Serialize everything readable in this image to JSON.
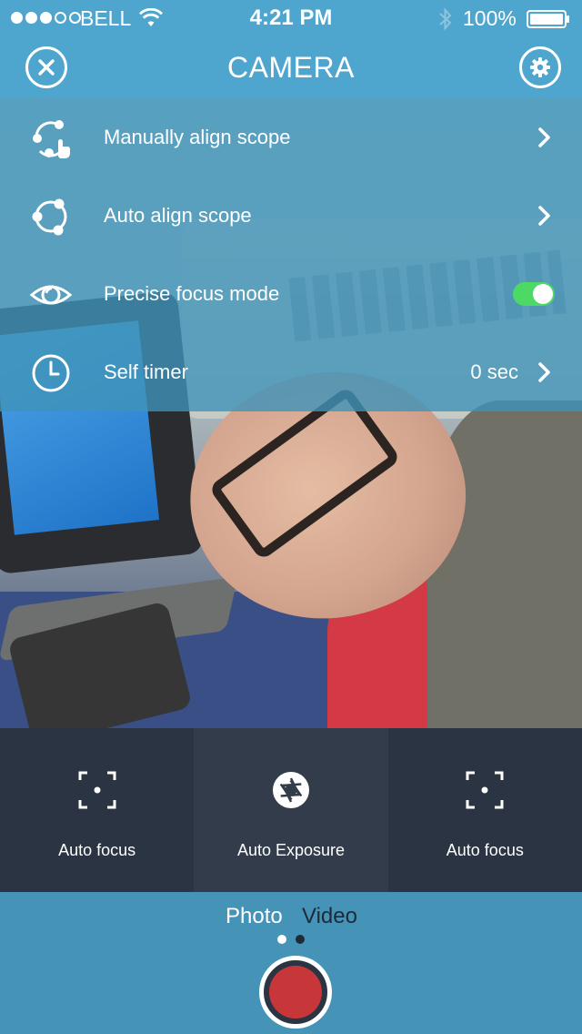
{
  "status_bar": {
    "carrier": "BELL",
    "time": "4:21 PM",
    "battery": "100%",
    "signal_bars_filled": 3,
    "signal_bars_total": 5
  },
  "header": {
    "title": "CAMERA",
    "close_icon": "close-icon",
    "settings_icon": "gear-icon"
  },
  "menu": {
    "items": [
      {
        "label": "Manually align scope",
        "icon": "manual-align-icon",
        "accessory": "chevron"
      },
      {
        "label": "Auto align scope",
        "icon": "auto-align-icon",
        "accessory": "chevron"
      },
      {
        "label": "Precise focus mode",
        "icon": "eye-icon",
        "accessory": "toggle",
        "toggle_on": true
      },
      {
        "label": "Self timer",
        "icon": "clock-icon",
        "accessory": "chevron",
        "value": "0 sec"
      }
    ]
  },
  "controls": [
    {
      "label": "Auto focus",
      "icon": "focus-icon"
    },
    {
      "label": "Auto Exposure",
      "icon": "aperture-icon"
    },
    {
      "label": "Auto focus",
      "icon": "focus-icon"
    }
  ],
  "mode_switch": {
    "options": [
      "Photo",
      "Video"
    ],
    "selected": "Photo",
    "page_index": 0,
    "page_count": 2
  },
  "colors": {
    "header_bg": "#4ea6cf",
    "menu_overlay": "#3e92b8",
    "controls_bg": "#2b3442",
    "bottom_bg": "#4693b8",
    "toggle_on": "#4cd964",
    "record": "#c7373a"
  }
}
